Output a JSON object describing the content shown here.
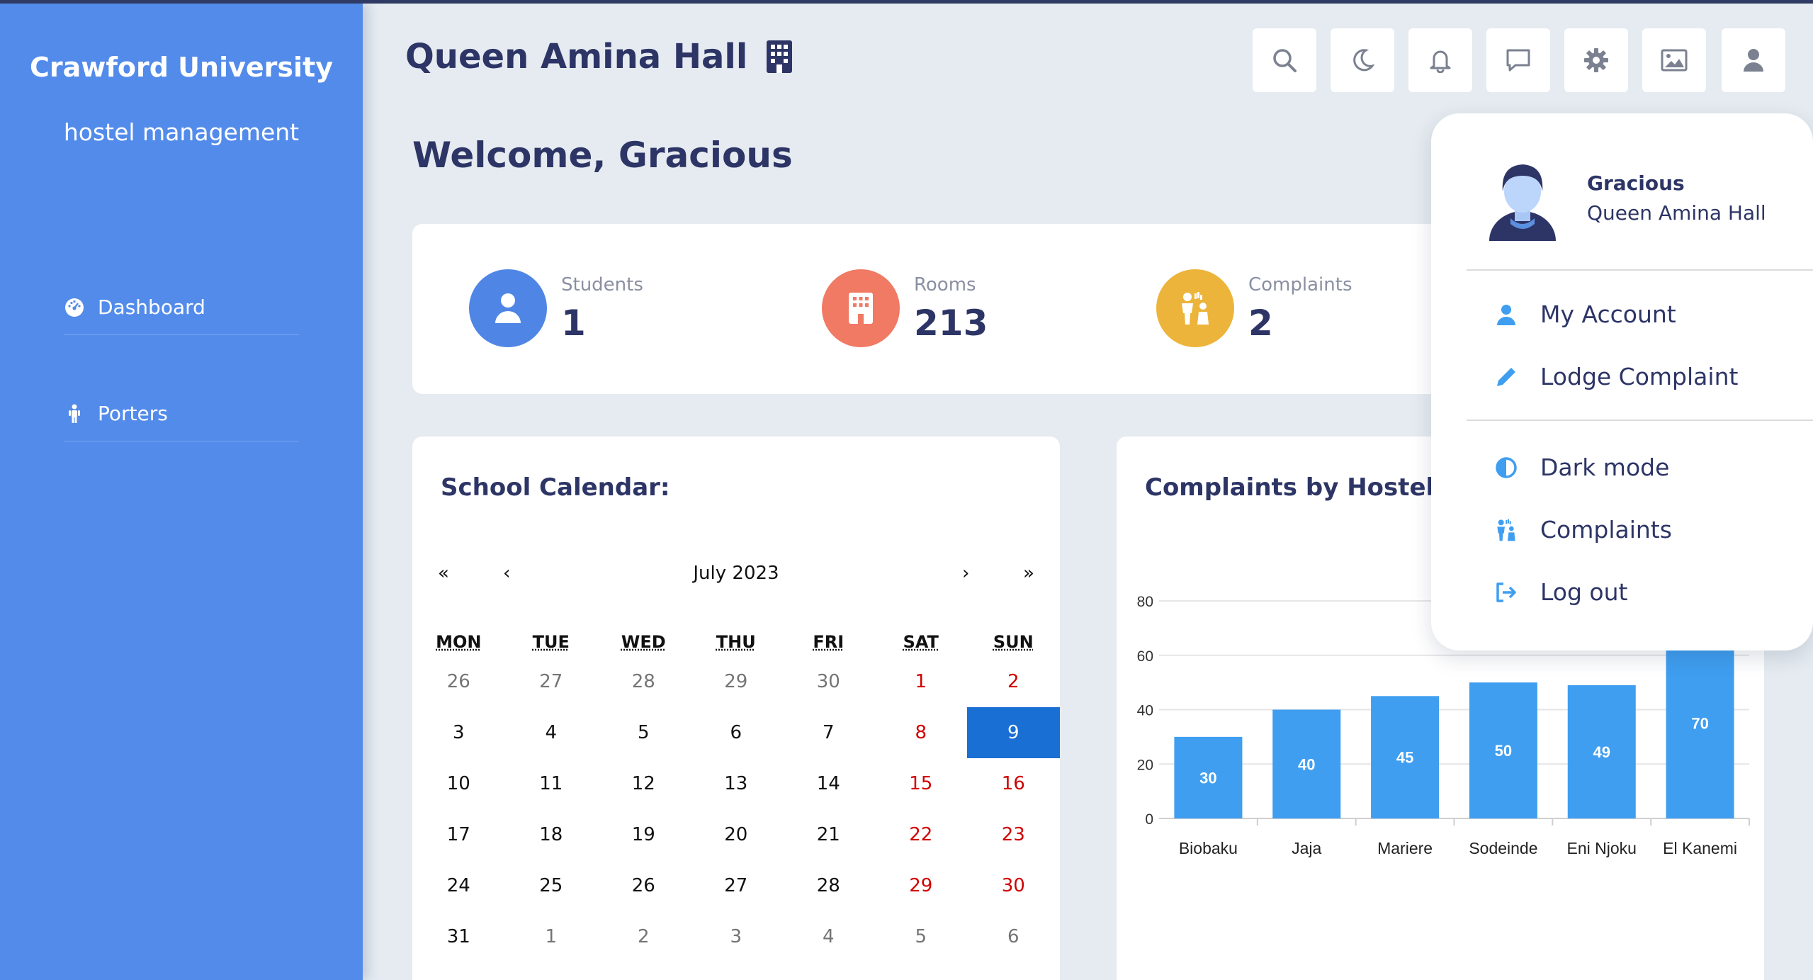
{
  "sidebar": {
    "brand": "Crawford University",
    "subtitle": "hostel management",
    "items": [
      {
        "label": "Dashboard",
        "icon": "dashboard-gauge-icon"
      },
      {
        "label": "Porters",
        "icon": "person-standing-icon"
      }
    ]
  },
  "header": {
    "title": "Queen Amina Hall",
    "title_icon": "building-icon",
    "toolbar": [
      "search-icon",
      "moon-icon",
      "bell-icon",
      "chat-icon",
      "gear-icon",
      "image-icon",
      "user-icon"
    ]
  },
  "welcome": "Welcome, Gracious",
  "stats": [
    {
      "label": "Students",
      "value": "1",
      "color": "#4f86e6",
      "icon": "user-icon"
    },
    {
      "label": "Rooms",
      "value": "213",
      "color": "#f07a64",
      "icon": "building-icon"
    },
    {
      "label": "Complaints",
      "value": "2",
      "color": "#ecb43a",
      "icon": "complaint-icon"
    }
  ],
  "calendar": {
    "title": "School Calendar:",
    "month": "July 2023",
    "nav": {
      "prev_year": "«",
      "prev_month": "‹",
      "next_month": "›",
      "next_year": "»"
    },
    "weekdays": [
      "MON",
      "TUE",
      "WED",
      "THU",
      "FRI",
      "SAT",
      "SUN"
    ],
    "weeks": [
      [
        "26",
        "27",
        "28",
        "29",
        "30",
        "1",
        "2"
      ],
      [
        "3",
        "4",
        "5",
        "6",
        "7",
        "8",
        "9"
      ],
      [
        "10",
        "11",
        "12",
        "13",
        "14",
        "15",
        "16"
      ],
      [
        "17",
        "18",
        "19",
        "20",
        "21",
        "22",
        "23"
      ],
      [
        "24",
        "25",
        "26",
        "27",
        "28",
        "29",
        "30"
      ],
      [
        "31",
        "1",
        "2",
        "3",
        "4",
        "5",
        "6"
      ]
    ],
    "selected": "9"
  },
  "chart": {
    "title": "Complaints by Hostels:"
  },
  "chart_data": {
    "type": "bar",
    "categories": [
      "Biobaku",
      "Jaja",
      "Mariere",
      "Sodeinde",
      "Eni Njoku",
      "El Kanemi"
    ],
    "values": [
      30,
      40,
      45,
      50,
      49,
      70
    ],
    "ylim": [
      0,
      80
    ],
    "yticks": [
      0,
      20,
      40,
      60,
      80
    ],
    "bar_color": "#3f9ef0",
    "grid": true,
    "data_labels": true
  },
  "user_menu": {
    "name": "Gracious",
    "hall": "Queen Amina Hall",
    "items": [
      {
        "label": "My Account",
        "icon": "user-icon"
      },
      {
        "label": "Lodge Complaint",
        "icon": "pencil-icon"
      },
      {
        "label": "Dark mode",
        "icon": "half-circle-icon"
      },
      {
        "label": "Complaints",
        "icon": "complaint-icon"
      },
      {
        "label": "Log out",
        "icon": "logout-icon"
      }
    ]
  },
  "colors": {
    "sidebar": "#528bea",
    "navy": "#2d3566",
    "accent": "#3f9ef0",
    "background": "#e5ebf0"
  }
}
